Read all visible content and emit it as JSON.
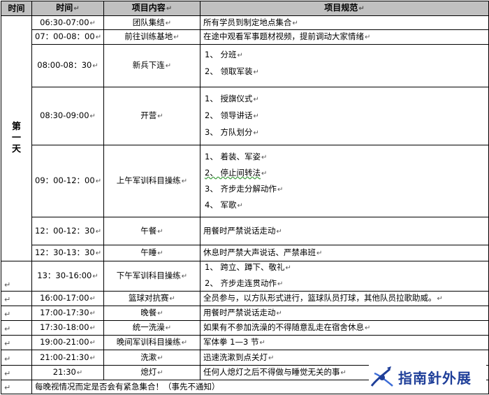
{
  "mark": "↵",
  "headers": [
    "时间",
    "时间",
    "项目内容",
    "项目规范"
  ],
  "day_label": [
    "第",
    "一",
    "天"
  ],
  "rows": [
    {
      "time": "06:30-07:00",
      "item": "团队集结",
      "spec": [
        "所有学员到制定地点集合"
      ]
    },
    {
      "time": "07：00-08：00",
      "item": "前往训练基地",
      "spec": [
        "在途中观看军事题材视频，提前调动大家情绪"
      ]
    },
    {
      "time": "08:00-08：30",
      "item": "新兵下连",
      "spec": [
        "1、 分班",
        "2、 领取军装"
      ]
    },
    {
      "time": "08:30-09:00",
      "item": "开营",
      "spec": [
        "1、 授旗仪式",
        "2、 领导讲话",
        "3、 方队划分"
      ]
    },
    {
      "time": "09：00-12：00",
      "item": "上午军训科目操练",
      "spec": [
        "1、 着装、军姿",
        "2、 停止间转法",
        "3、 齐步走分解动作",
        "4、 军歌"
      ]
    },
    {
      "time": "12：00-12：30",
      "item": "午餐",
      "spec": [
        "用餐时严禁说话走动"
      ]
    },
    {
      "time": "12：30-13：30",
      "item": "午睡",
      "spec": [
        "休息时严禁大声说话、严禁串班"
      ]
    },
    {
      "time": "13：30-16:00",
      "item": "下午军训科目操练",
      "spec": [
        "1、 跨立、蹲下、敬礼",
        "2、 齐步走连贯动作"
      ]
    },
    {
      "time": "16:00-17:00",
      "item": "篮球对抗赛",
      "spec": [
        "全员参与，以方队形式进行，篮球队员打球，其他队员拉歌助威。"
      ]
    },
    {
      "time": "17:00-17:30",
      "item": "晚餐",
      "spec": [
        "用餐时严禁说话走动"
      ]
    },
    {
      "time": "17:30-18:00",
      "item": "统一洗澡",
      "spec": [
        "如果有不参加洗澡的不得随意乱走在宿舍休息"
      ]
    },
    {
      "time": "19:00-21:00",
      "item": "晚间军训科目操练",
      "spec": [
        "军体拳 1—3 节"
      ]
    },
    {
      "time": "21:00-21:30",
      "item": "洗漱",
      "spec": [
        "迅速洗漱到点关灯"
      ]
    },
    {
      "time": "21:30",
      "item": "熄灯",
      "spec": [
        "任何人熄灯之后不得做与睡觉无关的事"
      ]
    }
  ],
  "footer_note": "每晚视情况而定是否会有紧急集合！（事先不通知）",
  "logo_text": "指南針外展",
  "colors": {
    "header_bg": "#c0c0c0",
    "logo_blue": "#1f3f99"
  }
}
